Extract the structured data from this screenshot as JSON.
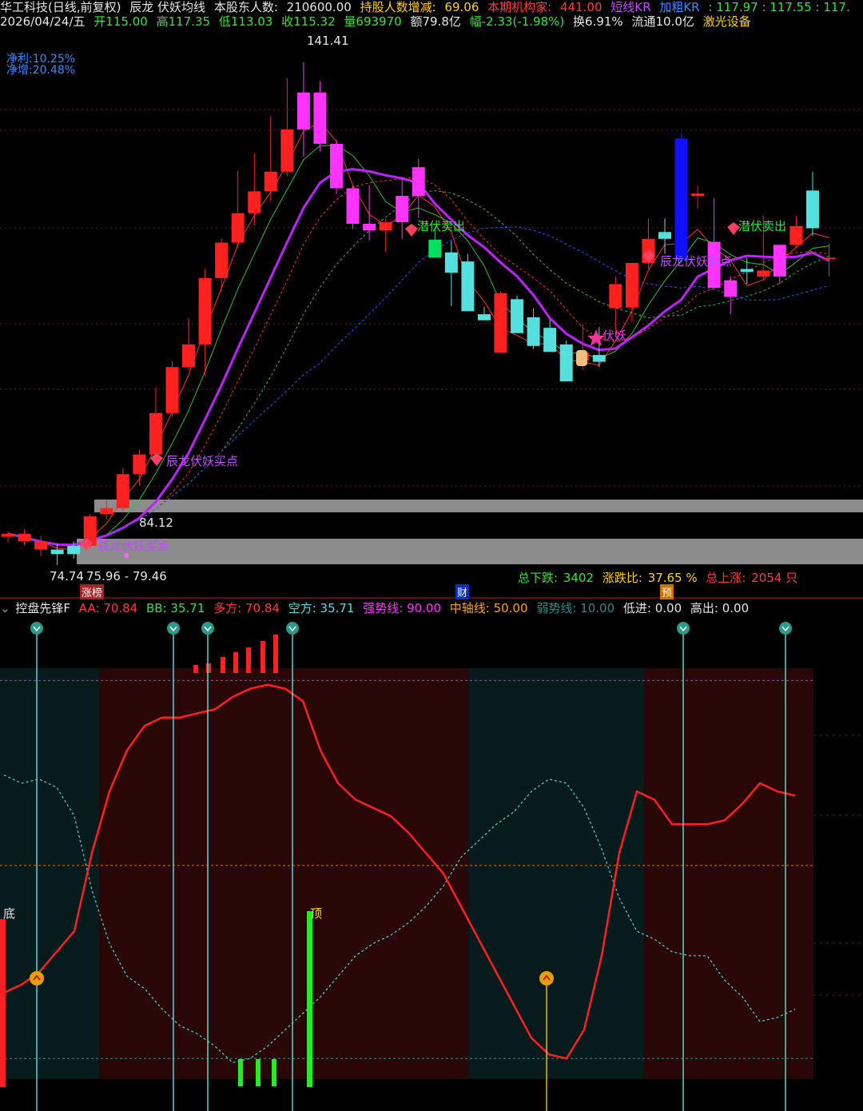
{
  "header": {
    "stock_title": "华工科技(日线,前复权)",
    "indicator_name": "辰龙 伏妖均线",
    "shareholders_label": "本股东人数:",
    "shareholders_value": "210600.00",
    "holder_change_label": "持股人数增减:",
    "holder_change_value": "69.06",
    "institutions_label": "本期机构家:",
    "institutions_value": "441.00",
    "short_kr": "短线KR",
    "plus_kr": "加粗KR",
    "kr_values": ": 117.97 : 117.55 : 117."
  },
  "quote": {
    "date": "2026/04/24/五",
    "open": "开115.00",
    "high": "高117.35",
    "low": "低113.03",
    "close": "收115.32",
    "volume": "量693970",
    "amount": "额79.8亿",
    "change": "幅-2.33(-1.98%)",
    "turnover": "换6.91%",
    "float": "流通10.0亿",
    "sector": "激光设备"
  },
  "fundamentals": {
    "net_profit": "净利:10.25%",
    "net_growth": "净增:20.48%"
  },
  "price_annotations": {
    "high_mark": "141.41",
    "low_mark": "74.74",
    "range_text": "75.96 - 79.46",
    "mid_text": "84.12",
    "buy_point_1": "辰龙伏妖买点",
    "buy_point_2": "辰龙伏妖买点",
    "sell_1": "潜伏卖出",
    "sell_2": "潜伏卖出",
    "buy_point_3": "辰龙伏妖买点",
    "fuyao": "伏妖",
    "tag_zhangting": "涨榜",
    "tag_cai": "财",
    "tag_yu": "预"
  },
  "market_stats": {
    "total_down_label": "总下跌:",
    "total_down": "3402",
    "ratio_label": "涨跌比:",
    "ratio": "37.65 %",
    "up_label": "总上涨:",
    "up": "2054 只"
  },
  "sub_indicator": {
    "name": "控盘先锋F",
    "aa": "AA: 70.84",
    "bb": "BB: 35.71",
    "bull": "多方: 70.84",
    "bear": "空方: 35.71",
    "strong": "强势线: 90.00",
    "mid": "中轴线: 50.00",
    "weak": "弱势线: 10.00",
    "low_in": "低进: 0.00",
    "high_out": "高出: 0.00",
    "bottom_label": "底",
    "top_label": "顶"
  },
  "colors": {
    "up": "#ff2020",
    "down": "#55e0e0",
    "magenta": "#ff33ff",
    "blue": "#1010ff",
    "bull_line": "#ff2020",
    "bear_line": "#55d5d5"
  },
  "chart_data": {
    "type": "candlestick",
    "price_range": [
      70,
      145
    ],
    "candles": [
      [
        78.5,
        79.2,
        77.8,
        78.9
      ],
      [
        78.9,
        79.5,
        77.4,
        77.9
      ],
      [
        77.9,
        78.6,
        75.9,
        76.8
      ],
      [
        76.8,
        77.6,
        74.74,
        76.2
      ],
      [
        76.2,
        77.9,
        75.6,
        77.3
      ],
      [
        77.3,
        81.5,
        77.0,
        81.2
      ],
      [
        81.5,
        83.5,
        80.9,
        82.3
      ],
      [
        82.3,
        87.6,
        82.0,
        86.8
      ],
      [
        86.8,
        90.0,
        85.3,
        89.4
      ],
      [
        89.4,
        98.3,
        89.0,
        94.9
      ],
      [
        94.9,
        101.8,
        94.4,
        101.0
      ],
      [
        101.0,
        107.5,
        100.6,
        104.0
      ],
      [
        104.0,
        114.0,
        99.8,
        112.8
      ],
      [
        112.8,
        118.0,
        111.0,
        117.5
      ],
      [
        117.5,
        127.0,
        116.8,
        121.4
      ],
      [
        121.4,
        129.3,
        119.8,
        124.3
      ],
      [
        124.3,
        134.3,
        123.0,
        126.9
      ],
      [
        126.9,
        139.3,
        126.3,
        132.5
      ],
      [
        132.5,
        141.41,
        128.9,
        137.4
      ],
      [
        137.4,
        138.9,
        129.6,
        130.6
      ],
      [
        130.6,
        131.1,
        123.9,
        124.7
      ],
      [
        124.7,
        125.1,
        119.3,
        120.0
      ],
      [
        120.0,
        125.1,
        117.8,
        119.1
      ],
      [
        119.1,
        120.7,
        116.3,
        120.2
      ],
      [
        120.2,
        126.2,
        118.0,
        123.7
      ],
      [
        123.7,
        128.6,
        120.8,
        127.5
      ],
      [
        117.9,
        119.6,
        116.0,
        115.5
      ],
      [
        116.2,
        117.7,
        109.1,
        113.5
      ],
      [
        115.0,
        116.0,
        110.0,
        108.4
      ],
      [
        108.0,
        109.0,
        107.5,
        107.2
      ],
      [
        110.8,
        111.0,
        103.6,
        102.9
      ],
      [
        110.0,
        110.5,
        107.0,
        105.5
      ],
      [
        107.6,
        108.8,
        103.4,
        103.8
      ],
      [
        106.2,
        107.3,
        104.2,
        103.0
      ],
      [
        104.0,
        104.5,
        102.0,
        99.1
      ],
      [
        101.9,
        106.7,
        100.6,
        102.9
      ],
      [
        102.6,
        106.3,
        101.0,
        101.7
      ],
      [
        112.0,
        113.0,
        105.2,
        108.8
      ],
      [
        108.9,
        112.8,
        107.0,
        114.8
      ],
      [
        114.8,
        120.7,
        114.0,
        118.0
      ],
      [
        118.0,
        120.7,
        116.0,
        118.9
      ],
      [
        131.3,
        132.0,
        116.0,
        115.2
      ],
      [
        124.0,
        125.0,
        122.0,
        123.7
      ],
      [
        117.6,
        123.4,
        117.0,
        111.5
      ],
      [
        112.5,
        113.0,
        108.0,
        110.3
      ],
      [
        114.0,
        115.5,
        112.0,
        113.6
      ],
      [
        113.0,
        121.1,
        112.5,
        113.8
      ],
      [
        113.0,
        117.0,
        112.0,
        117.2
      ],
      [
        117.2,
        121.0,
        116.8,
        119.7
      ],
      [
        124.4,
        126.9,
        118.4,
        119.4
      ],
      [
        115.5,
        117.4,
        113.0,
        115.3
      ]
    ],
    "candle_colors": [
      "r",
      "r",
      "r",
      "c",
      "c",
      "r",
      "r",
      "r",
      "r",
      "r",
      "r",
      "r",
      "r",
      "r",
      "r",
      "r",
      "r",
      "r",
      "m",
      "m",
      "m",
      "m",
      "m",
      "r",
      "m",
      "m",
      "g",
      "c",
      "c",
      "c",
      "r",
      "c",
      "c",
      "c",
      "c",
      "r",
      "c",
      "r",
      "r",
      "r",
      "c",
      "b",
      "r",
      "m",
      "m",
      "c",
      "r",
      "m",
      "r",
      "c",
      "r"
    ],
    "sub_series": {
      "name_bull": "多方",
      "name_bear": "空方",
      "bull": [
        21,
        23,
        26,
        31,
        36,
        55,
        70,
        80,
        86,
        88,
        88,
        89,
        90,
        93,
        95,
        96,
        95,
        92,
        80,
        72,
        68,
        66,
        64,
        60,
        55,
        50,
        42,
        34,
        26,
        18,
        10,
        6,
        5,
        12,
        30,
        55,
        70,
        68,
        62,
        62,
        62,
        63,
        67,
        72,
        70,
        69
      ],
      "bear": [
        74,
        72,
        73,
        71,
        64,
        46,
        33,
        25,
        22,
        17,
        13,
        11,
        8,
        4,
        5,
        8,
        12,
        16,
        20,
        25,
        30,
        33,
        35,
        38,
        42,
        47,
        54,
        58,
        62,
        65,
        70,
        73,
        72,
        66,
        56,
        44,
        36,
        34,
        31,
        30,
        30,
        24,
        20,
        14,
        15,
        17
      ],
      "ylim": [
        0,
        100
      ]
    }
  }
}
